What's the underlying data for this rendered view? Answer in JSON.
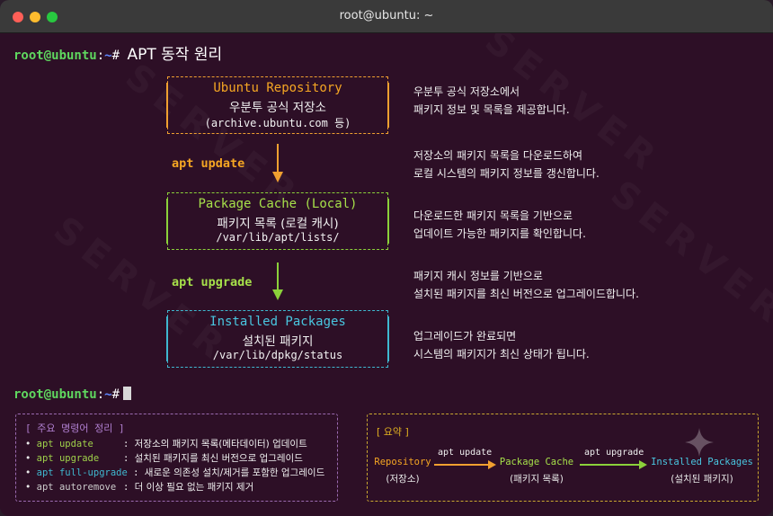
{
  "window": {
    "title": "root@ubuntu: ~"
  },
  "prompt": {
    "user": "root@ubuntu",
    "colon": ":",
    "path": "~",
    "symbol": "#",
    "command": "APT 동작 원리"
  },
  "boxes": [
    {
      "title": "Ubuntu Repository",
      "subtitle": "우분투 공식 저장소",
      "path": "(archive.ubuntu.com 등)"
    },
    {
      "title": "Package Cache (Local)",
      "subtitle": "패키지 목록 (로컬 캐시)",
      "path": "/var/lib/apt/lists/"
    },
    {
      "title": "Installed Packages",
      "subtitle": "설치된 패키지",
      "path": "/var/lib/dpkg/status"
    }
  ],
  "commands": {
    "update": "apt update",
    "upgrade": "apt upgrade"
  },
  "descriptions": [
    [
      "우분투 공식 저장소에서",
      "패키지 정보 및 목록을 제공합니다."
    ],
    [
      "저장소의 패키지 목록을 다운로드하여",
      "로컬 시스템의 패키지 정보를 갱신합니다."
    ],
    [
      "다운로드한 패키지 목록을 기반으로",
      "업데이트 가능한 패키지를 확인합니다."
    ],
    [
      "패키지 캐시 정보를 기반으로",
      "설치된 패키지를 최신 버전으로 업그레이드합니다."
    ],
    [
      "업그레이드가 완료되면",
      "시스템의 패키지가 최신 상태가 됩니다."
    ]
  ],
  "summary": {
    "title": "[ 주요 명령어 정리 ]",
    "items": [
      {
        "bullet": "•",
        "cmd": "apt update",
        "sep": ":",
        "desc": "저장소의 패키지 목록(메타데이터) 업데이트"
      },
      {
        "bullet": "•",
        "cmd": "apt upgrade",
        "sep": ":",
        "desc": "설치된 패키지를 최신 버전으로 업그레이드"
      },
      {
        "bullet": "•",
        "cmd": "apt full-upgrade",
        "sep": ":",
        "desc": "새로운 의존성 설치/제거를 포함한 업그레이드"
      },
      {
        "bullet": "•",
        "cmd": "apt autoremove",
        "sep": ":",
        "desc": "더 이상 필요 없는 패키지 제거"
      }
    ]
  },
  "flow": {
    "title": "[ 요약 ]",
    "nodes": [
      {
        "name": "Repository",
        "sub": "(저장소)"
      },
      {
        "name": "Package Cache",
        "sub": "(패키지 목록)"
      },
      {
        "name": "Installed Packages",
        "sub": "(설치된 패키지)"
      }
    ],
    "edges": [
      "apt update",
      "apt upgrade"
    ]
  },
  "watermark": "SERVER",
  "colors": {
    "orange": "#f5a623",
    "green": "#8bd13a",
    "cyan": "#3fb8d0",
    "purple": "#9a6ab0",
    "gold": "#c9a830",
    "background": "#2d0f26"
  }
}
